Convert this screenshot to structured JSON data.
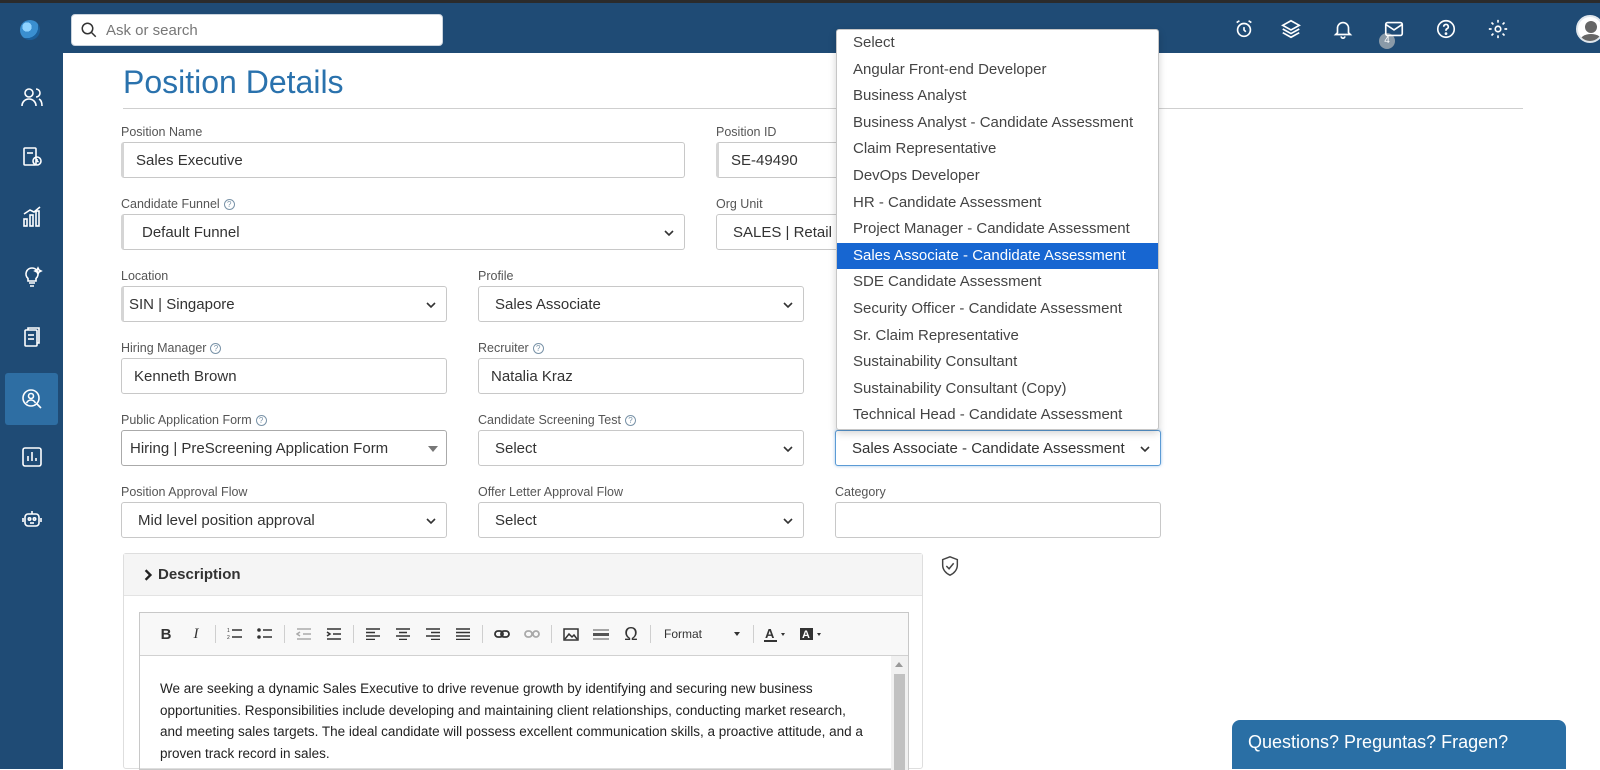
{
  "search": {
    "placeholder": "Ask or search"
  },
  "header": {
    "notification_count": "4"
  },
  "page": {
    "title": "Position Details"
  },
  "form": {
    "position_name": {
      "label": "Position Name",
      "value": "Sales Executive"
    },
    "position_id": {
      "label": "Position ID",
      "value": "SE-49490"
    },
    "candidate_funnel": {
      "label": "Candidate Funnel",
      "value": "Default Funnel"
    },
    "org_unit": {
      "label": "Org Unit",
      "value": "SALES | Retail"
    },
    "location": {
      "label": "Location",
      "value": "SIN | Singapore"
    },
    "profile": {
      "label": "Profile",
      "value": "Sales Associate"
    },
    "hiring_manager": {
      "label": "Hiring Manager",
      "value": "Kenneth Brown"
    },
    "recruiter": {
      "label": "Recruiter",
      "value": "Natalia Kraz"
    },
    "public_application_form": {
      "label": "Public Application Form",
      "value": "Hiring | PreScreening Application Form"
    },
    "candidate_screening_test": {
      "label": "Candidate Screening Test",
      "value": "Select"
    },
    "assessment": {
      "value": "Sales Associate - Candidate Assessment"
    },
    "position_approval_flow": {
      "label": "Position Approval Flow",
      "value": "Mid level position approval"
    },
    "offer_letter_approval_flow": {
      "label": "Offer Letter Approval Flow",
      "value": "Select"
    },
    "category": {
      "label": "Category",
      "value": ""
    }
  },
  "assessment_dropdown": {
    "options": [
      "Select",
      "Angular Front-end Developer",
      "Business Analyst",
      "Business Analyst - Candidate Assessment",
      "Claim Representative",
      "DevOps Developer",
      "HR - Candidate Assessment",
      "Project Manager - Candidate Assessment",
      "Sales Associate - Candidate Assessment",
      "SDE Candidate Assessment",
      "Security Officer - Candidate Assessment",
      "Sr. Claim Representative",
      "Sustainability Consultant",
      "Sustainability Consultant (Copy)",
      "Technical Head - Candidate Assessment"
    ],
    "selected_index": 8
  },
  "description": {
    "heading": "Description",
    "toolbar": {
      "format_label": "Format"
    },
    "text": "We are seeking a dynamic Sales Executive to drive revenue growth by identifying and securing new business opportunities. Responsibilities include developing and maintaining client relationships, conducting market research, and meeting sales targets. The ideal candidate will possess excellent communication skills, a proactive attitude, and a proven track record in sales."
  },
  "chat": {
    "label": "Questions? Preguntas? Fragen?"
  },
  "colors": {
    "header_bg": "#1f4b75",
    "title": "#2a72ad",
    "selected_option": "#1766d1",
    "chat_bg": "#2a6fa5"
  }
}
